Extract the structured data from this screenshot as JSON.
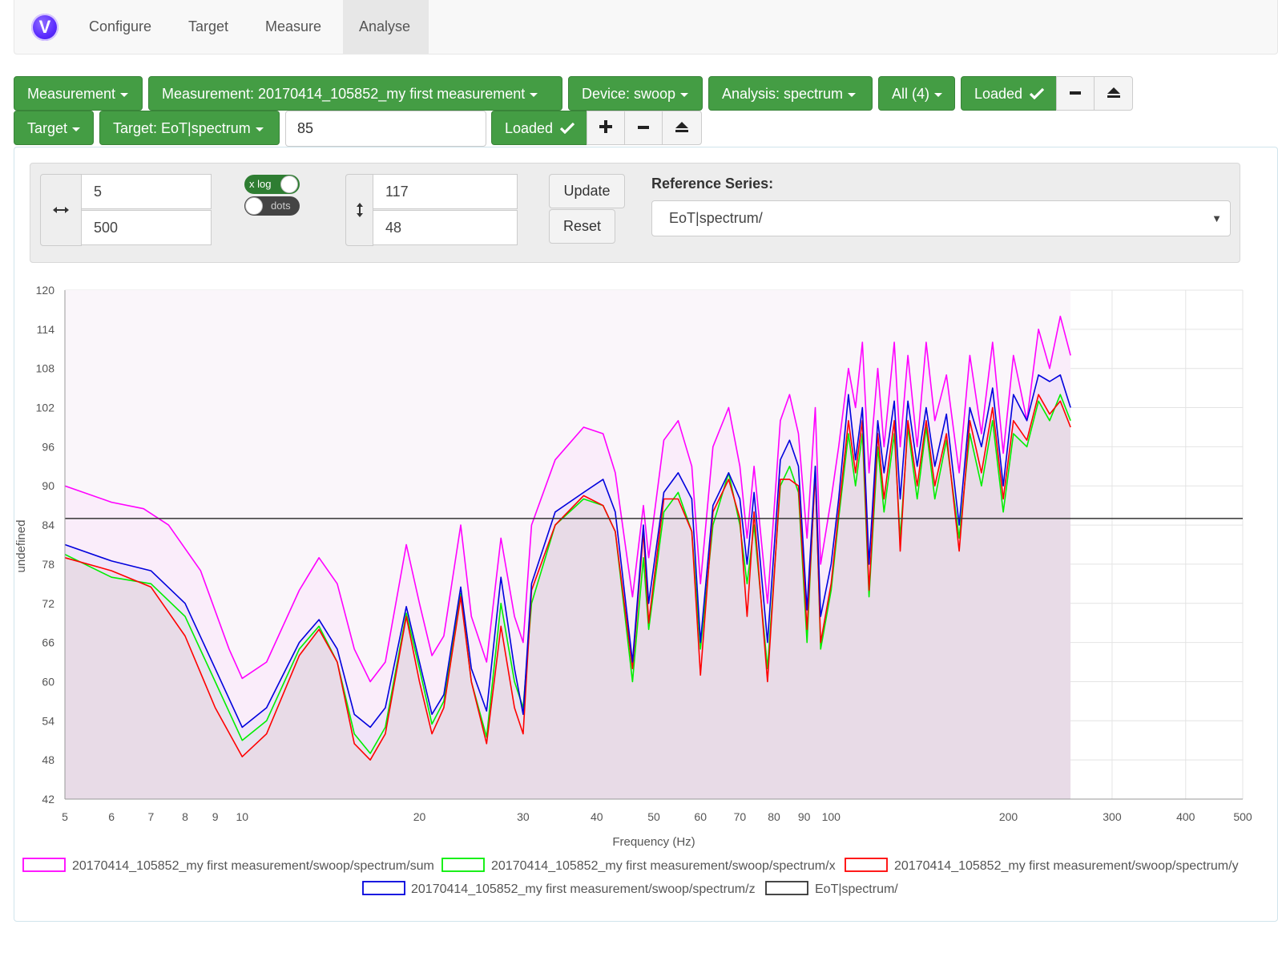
{
  "nav": {
    "logo_letter": "V",
    "tabs": [
      {
        "label": "Configure"
      },
      {
        "label": "Target"
      },
      {
        "label": "Measure"
      },
      {
        "label": "Analyse",
        "active": true
      }
    ]
  },
  "toolbar1": {
    "measurement": "Measurement",
    "measurement_name": "Measurement: 20170414_105852_my first measurement",
    "device": "Device: swoop",
    "analysis": "Analysis: spectrum",
    "all": "All (4)",
    "loaded": "Loaded",
    "remove_icon": "minus-icon",
    "eject_icon": "eject-icon"
  },
  "toolbar2": {
    "target": "Target",
    "target_name": "Target: EoT|spectrum",
    "target_value": "85",
    "loaded": "Loaded",
    "add_icon": "plus-icon",
    "remove_icon": "minus-icon",
    "eject_icon": "eject-icon"
  },
  "controls": {
    "x_min": "5",
    "x_max": "500",
    "x_log_label": "x log",
    "x_log_on": true,
    "dots_label": "dots",
    "dots_on": false,
    "y_max": "117",
    "y_min": "48",
    "update_label": "Update",
    "reset_label": "Reset",
    "reference_label": "Reference Series:",
    "reference_value": "EoT|spectrum/"
  },
  "chart_data": {
    "type": "area",
    "xlabel": "Frequency (Hz)",
    "ylabel": "undefined",
    "x_scale": "log",
    "xlim": [
      5,
      500
    ],
    "ylim": [
      42,
      120
    ],
    "x_ticks": [
      5,
      6,
      7,
      8,
      9,
      10,
      20,
      30,
      40,
      50,
      60,
      70,
      80,
      90,
      100,
      200,
      300,
      400,
      500
    ],
    "y_ticks": [
      42,
      48,
      54,
      60,
      66,
      72,
      78,
      84,
      90,
      96,
      102,
      108,
      114,
      120
    ],
    "grid": true,
    "legend_position": "bottom",
    "series": [
      {
        "name": "20170414_105852_my first measurement/swoop/spectrum/sum",
        "color": "#ff00ff",
        "points": [
          [
            5,
            90
          ],
          [
            6,
            87.5
          ],
          [
            6.8,
            86.5
          ],
          [
            7.5,
            84
          ],
          [
            8.5,
            77
          ],
          [
            9.5,
            65
          ],
          [
            10,
            60.5
          ],
          [
            11,
            63
          ],
          [
            12.5,
            74
          ],
          [
            13.5,
            79
          ],
          [
            14.5,
            75
          ],
          [
            15.5,
            65
          ],
          [
            16.5,
            60
          ],
          [
            17.5,
            63
          ],
          [
            19,
            81
          ],
          [
            20,
            72
          ],
          [
            21,
            64
          ],
          [
            22,
            67
          ],
          [
            23.5,
            84
          ],
          [
            24.5,
            70
          ],
          [
            26,
            63
          ],
          [
            27.5,
            82
          ],
          [
            29,
            70
          ],
          [
            30,
            66
          ],
          [
            31,
            84
          ],
          [
            34,
            94
          ],
          [
            38,
            99
          ],
          [
            41,
            98
          ],
          [
            43,
            92
          ],
          [
            46,
            73
          ],
          [
            48,
            87
          ],
          [
            49,
            79
          ],
          [
            52,
            97
          ],
          [
            55,
            100
          ],
          [
            58,
            93
          ],
          [
            60,
            75
          ],
          [
            63,
            96
          ],
          [
            67,
            102
          ],
          [
            70,
            93
          ],
          [
            72,
            82
          ],
          [
            74,
            93
          ],
          [
            78,
            72
          ],
          [
            82,
            100
          ],
          [
            85,
            104
          ],
          [
            88,
            98
          ],
          [
            91,
            82
          ],
          [
            94,
            102
          ],
          [
            96,
            78
          ],
          [
            100,
            88
          ],
          [
            103,
            96
          ],
          [
            107,
            108
          ],
          [
            110,
            102
          ],
          [
            113,
            112
          ],
          [
            116,
            92
          ],
          [
            120,
            108
          ],
          [
            123,
            96
          ],
          [
            128,
            112
          ],
          [
            131,
            96
          ],
          [
            135,
            110
          ],
          [
            140,
            96
          ],
          [
            145,
            112
          ],
          [
            150,
            100
          ],
          [
            157,
            107
          ],
          [
            165,
            92
          ],
          [
            172,
            110
          ],
          [
            180,
            98
          ],
          [
            188,
            112
          ],
          [
            196,
            95
          ],
          [
            204,
            110
          ],
          [
            215,
            100
          ],
          [
            225,
            114
          ],
          [
            235,
            108
          ],
          [
            245,
            116
          ],
          [
            255,
            110
          ]
        ]
      },
      {
        "name": "20170414_105852_my first measurement/swoop/spectrum/x",
        "color": "#00ee00",
        "points": [
          [
            5,
            79.5
          ],
          [
            6,
            76
          ],
          [
            7,
            75
          ],
          [
            8,
            70
          ],
          [
            9,
            60
          ],
          [
            10,
            51
          ],
          [
            11,
            54
          ],
          [
            12.5,
            65
          ],
          [
            13.5,
            68.5
          ],
          [
            14.5,
            63
          ],
          [
            15.5,
            52
          ],
          [
            16.5,
            49
          ],
          [
            17.5,
            53
          ],
          [
            19,
            70.5
          ],
          [
            20,
            62
          ],
          [
            21,
            53.5
          ],
          [
            22,
            57
          ],
          [
            23.5,
            73.5
          ],
          [
            24.5,
            60
          ],
          [
            26,
            51.5
          ],
          [
            27.5,
            72
          ],
          [
            29,
            60
          ],
          [
            30,
            56
          ],
          [
            31,
            72
          ],
          [
            34,
            84
          ],
          [
            38,
            88
          ],
          [
            41,
            87
          ],
          [
            43,
            83
          ],
          [
            46,
            60
          ],
          [
            48,
            79
          ],
          [
            49,
            68
          ],
          [
            52,
            86
          ],
          [
            55,
            89
          ],
          [
            58,
            83
          ],
          [
            60,
            65
          ],
          [
            63,
            84
          ],
          [
            67,
            92
          ],
          [
            70,
            84
          ],
          [
            72,
            75
          ],
          [
            74,
            84
          ],
          [
            78,
            62
          ],
          [
            82,
            90
          ],
          [
            85,
            93
          ],
          [
            88,
            89
          ],
          [
            91,
            66
          ],
          [
            94,
            93
          ],
          [
            96,
            65
          ],
          [
            100,
            74
          ],
          [
            103,
            85
          ],
          [
            107,
            98
          ],
          [
            110,
            90
          ],
          [
            113,
            98
          ],
          [
            116,
            73
          ],
          [
            120,
            96
          ],
          [
            123,
            86
          ],
          [
            128,
            98
          ],
          [
            131,
            82
          ],
          [
            135,
            99
          ],
          [
            140,
            88
          ],
          [
            145,
            99
          ],
          [
            150,
            88
          ],
          [
            157,
            97
          ],
          [
            165,
            82
          ],
          [
            172,
            98
          ],
          [
            180,
            90
          ],
          [
            188,
            100
          ],
          [
            196,
            86
          ],
          [
            204,
            98
          ],
          [
            215,
            96
          ],
          [
            225,
            103
          ],
          [
            235,
            100
          ],
          [
            245,
            104
          ],
          [
            255,
            100
          ]
        ]
      },
      {
        "name": "20170414_105852_my first measurement/swoop/spectrum/y",
        "color": "#ff0000",
        "points": [
          [
            5,
            79
          ],
          [
            6,
            77
          ],
          [
            7,
            74.5
          ],
          [
            8,
            67
          ],
          [
            9,
            56
          ],
          [
            10,
            48.5
          ],
          [
            11,
            52
          ],
          [
            12.5,
            64
          ],
          [
            13.5,
            68
          ],
          [
            14.5,
            63
          ],
          [
            15.5,
            50.5
          ],
          [
            16.5,
            48
          ],
          [
            17.5,
            52
          ],
          [
            19,
            70
          ],
          [
            20,
            60
          ],
          [
            21,
            52
          ],
          [
            22,
            56
          ],
          [
            23.5,
            73
          ],
          [
            24.5,
            60
          ],
          [
            26,
            50.5
          ],
          [
            27.5,
            68.5
          ],
          [
            29,
            56
          ],
          [
            30,
            52
          ],
          [
            31,
            74
          ],
          [
            34,
            84
          ],
          [
            38,
            88.5
          ],
          [
            41,
            87
          ],
          [
            43,
            83
          ],
          [
            46,
            62
          ],
          [
            48,
            83
          ],
          [
            49,
            69
          ],
          [
            52,
            88
          ],
          [
            55,
            88
          ],
          [
            58,
            83
          ],
          [
            60,
            61
          ],
          [
            63,
            86
          ],
          [
            67,
            91
          ],
          [
            70,
            85
          ],
          [
            72,
            70
          ],
          [
            74,
            86
          ],
          [
            78,
            60
          ],
          [
            82,
            91
          ],
          [
            85,
            91
          ],
          [
            88,
            90
          ],
          [
            91,
            68
          ],
          [
            94,
            92
          ],
          [
            96,
            66
          ],
          [
            100,
            75
          ],
          [
            103,
            86
          ],
          [
            107,
            100
          ],
          [
            110,
            92
          ],
          [
            113,
            100
          ],
          [
            116,
            74
          ],
          [
            120,
            98
          ],
          [
            123,
            88
          ],
          [
            128,
            100
          ],
          [
            131,
            80
          ],
          [
            135,
            100
          ],
          [
            140,
            90
          ],
          [
            145,
            100
          ],
          [
            150,
            90
          ],
          [
            157,
            98
          ],
          [
            165,
            80
          ],
          [
            172,
            100
          ],
          [
            180,
            92
          ],
          [
            188,
            102
          ],
          [
            196,
            88
          ],
          [
            204,
            100
          ],
          [
            215,
            97
          ],
          [
            225,
            104
          ],
          [
            235,
            101
          ],
          [
            245,
            103
          ],
          [
            255,
            99
          ]
        ]
      },
      {
        "name": "20170414_105852_my first measurement/swoop/spectrum/z",
        "color": "#0000dd",
        "points": [
          [
            5,
            81
          ],
          [
            6,
            78.5
          ],
          [
            7,
            77
          ],
          [
            8,
            72
          ],
          [
            9,
            62
          ],
          [
            10,
            53
          ],
          [
            11,
            56
          ],
          [
            12.5,
            66
          ],
          [
            13.5,
            69.5
          ],
          [
            14.5,
            65
          ],
          [
            15.5,
            55
          ],
          [
            16.5,
            53
          ],
          [
            17.5,
            56
          ],
          [
            19,
            71.5
          ],
          [
            20,
            63
          ],
          [
            21,
            55
          ],
          [
            22,
            58
          ],
          [
            23.5,
            74.5
          ],
          [
            24.5,
            62
          ],
          [
            26,
            55.5
          ],
          [
            27.5,
            76
          ],
          [
            29,
            62
          ],
          [
            30,
            55
          ],
          [
            31,
            75
          ],
          [
            34,
            86
          ],
          [
            38,
            89
          ],
          [
            41,
            91
          ],
          [
            43,
            86
          ],
          [
            46,
            63
          ],
          [
            48,
            84
          ],
          [
            49,
            72
          ],
          [
            52,
            89
          ],
          [
            55,
            92
          ],
          [
            58,
            88
          ],
          [
            60,
            66
          ],
          [
            63,
            87
          ],
          [
            67,
            92
          ],
          [
            70,
            88
          ],
          [
            72,
            78
          ],
          [
            74,
            89
          ],
          [
            78,
            66
          ],
          [
            82,
            94
          ],
          [
            85,
            97
          ],
          [
            88,
            93
          ],
          [
            91,
            71
          ],
          [
            94,
            93
          ],
          [
            96,
            70
          ],
          [
            100,
            78
          ],
          [
            103,
            88
          ],
          [
            107,
            104
          ],
          [
            110,
            94
          ],
          [
            113,
            102
          ],
          [
            116,
            78
          ],
          [
            120,
            100
          ],
          [
            123,
            92
          ],
          [
            128,
            103
          ],
          [
            131,
            88
          ],
          [
            135,
            103
          ],
          [
            140,
            93
          ],
          [
            145,
            102
          ],
          [
            150,
            93
          ],
          [
            157,
            101
          ],
          [
            165,
            84
          ],
          [
            172,
            102
          ],
          [
            180,
            96
          ],
          [
            188,
            105
          ],
          [
            196,
            90
          ],
          [
            204,
            104
          ],
          [
            215,
            100
          ],
          [
            225,
            107
          ],
          [
            235,
            106
          ],
          [
            245,
            107
          ],
          [
            255,
            102
          ]
        ]
      },
      {
        "name": "EoT|spectrum/",
        "color": "#333333",
        "points": [
          [
            5,
            85
          ],
          [
            500,
            85
          ]
        ]
      }
    ]
  }
}
